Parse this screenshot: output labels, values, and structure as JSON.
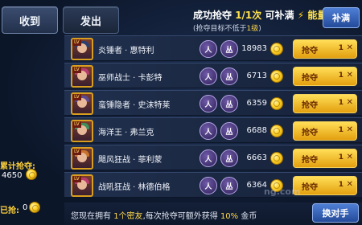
{
  "tabs": [
    {
      "label": "收到"
    },
    {
      "label": "发出"
    }
  ],
  "header": {
    "line1_prefix": "成功抢夺",
    "line1_count": "1/1次",
    "line1_mid": "可补满",
    "line1_energy": "能量",
    "line2_prefix": "(抢夺目标不低于",
    "line2_level": "1级",
    "line2_suffix": ")",
    "refill_label": "补满"
  },
  "left": {
    "total_label": "累计抢夺:",
    "total_value": "4650",
    "bottom_label": "已抢:",
    "bottom_value": "0"
  },
  "targets": [
    {
      "name": "炎锤者 · 惠特利",
      "power": "18983",
      "steal_label": "抢夺",
      "count": "1"
    },
    {
      "name": "巫师战士 · 卡彭特",
      "power": "6713",
      "steal_label": "抢夺",
      "count": "1"
    },
    {
      "name": "蛮锤隐者 · 史沫特莱",
      "power": "6359",
      "steal_label": "抢夺",
      "count": "1"
    },
    {
      "name": "海洋王 · 弗兰克",
      "power": "6688",
      "steal_label": "抢夺",
      "count": "1"
    },
    {
      "name": "飓风狂战 · 菲利蒙",
      "power": "6663",
      "steal_label": "抢夺",
      "count": "1"
    },
    {
      "name": "战吼狂战 · 林德伯格",
      "power": "6364",
      "steal_label": "抢夺",
      "count": "1"
    }
  ],
  "skill_labels": [
    "人",
    "丛"
  ],
  "footer": {
    "text_prefix": "您现在拥有",
    "friend_count": "1个密友",
    "text_mid": ",每次抢夺可额外获得",
    "bonus_percent": "10%",
    "text_suffix": "金币",
    "switch_label": "换对手"
  },
  "watermark": "ng.com",
  "colors": {
    "accent_yellow": "#ffd84a",
    "button_blue": "#3663b8",
    "steal_gold": "#f0b62a"
  }
}
